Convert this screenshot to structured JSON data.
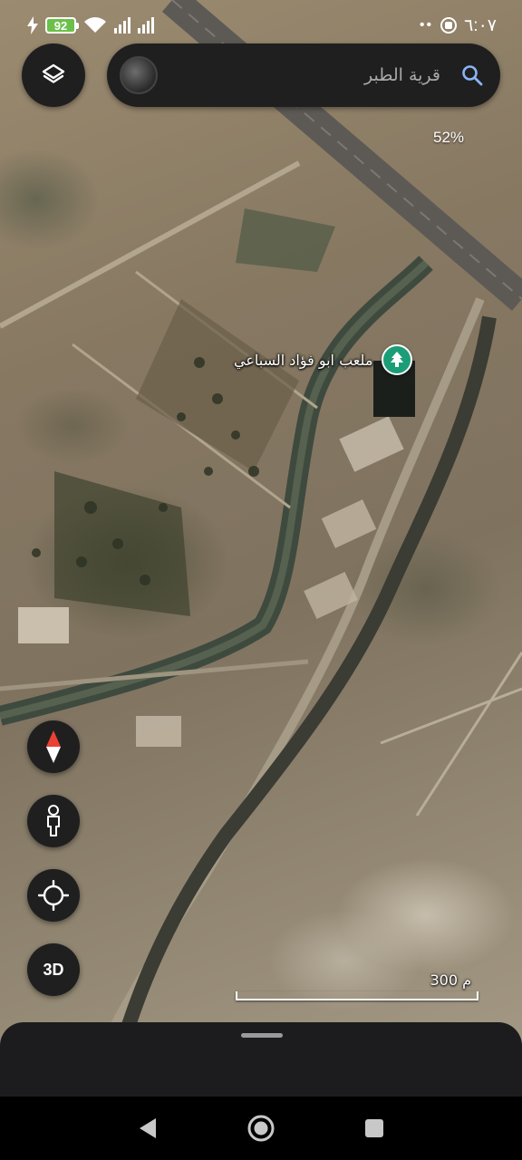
{
  "status_bar": {
    "battery_level": "92",
    "time": "٦:٠٧",
    "icons": [
      "charging-bolt-icon",
      "battery-icon",
      "wifi-icon",
      "signal-bars-icon",
      "signal-bars-icon",
      "notification-dots-icon",
      "screen-record-icon"
    ]
  },
  "top_bar": {
    "layers_icon": "layers-icon",
    "search": {
      "text": "قرية الطبر",
      "icon": "search-icon"
    }
  },
  "zoom": {
    "level": "52%",
    "icon": "moon-icon"
  },
  "place": {
    "name": "ملعب ابو فؤاد السباعي",
    "icon": "tree-pin-icon",
    "color": "#1b9e77"
  },
  "controls": {
    "compass_icon": "compass-icon",
    "pegman_icon": "pegman-icon",
    "my_location_icon": "my-location-icon",
    "view_3d_label": "3D"
  },
  "scale": {
    "label": "300 م"
  },
  "nav_bar": {
    "icons": [
      "back-icon",
      "home-icon",
      "recents-icon"
    ]
  }
}
